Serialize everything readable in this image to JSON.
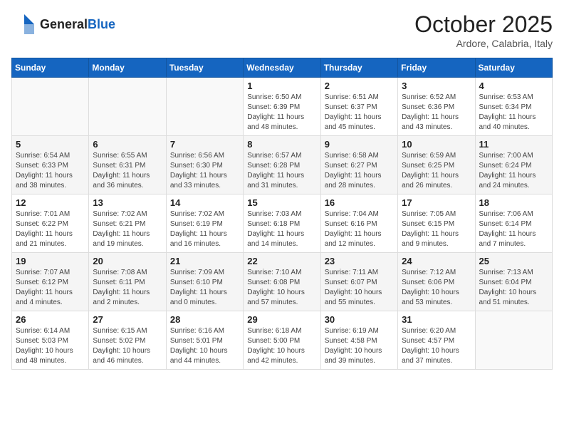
{
  "logo": {
    "general": "General",
    "blue": "Blue"
  },
  "header": {
    "month": "October 2025",
    "location": "Ardore, Calabria, Italy"
  },
  "weekdays": [
    "Sunday",
    "Monday",
    "Tuesday",
    "Wednesday",
    "Thursday",
    "Friday",
    "Saturday"
  ],
  "weeks": [
    [
      {
        "day": "",
        "info": ""
      },
      {
        "day": "",
        "info": ""
      },
      {
        "day": "",
        "info": ""
      },
      {
        "day": "1",
        "info": "Sunrise: 6:50 AM\nSunset: 6:39 PM\nDaylight: 11 hours\nand 48 minutes."
      },
      {
        "day": "2",
        "info": "Sunrise: 6:51 AM\nSunset: 6:37 PM\nDaylight: 11 hours\nand 45 minutes."
      },
      {
        "day": "3",
        "info": "Sunrise: 6:52 AM\nSunset: 6:36 PM\nDaylight: 11 hours\nand 43 minutes."
      },
      {
        "day": "4",
        "info": "Sunrise: 6:53 AM\nSunset: 6:34 PM\nDaylight: 11 hours\nand 40 minutes."
      }
    ],
    [
      {
        "day": "5",
        "info": "Sunrise: 6:54 AM\nSunset: 6:33 PM\nDaylight: 11 hours\nand 38 minutes."
      },
      {
        "day": "6",
        "info": "Sunrise: 6:55 AM\nSunset: 6:31 PM\nDaylight: 11 hours\nand 36 minutes."
      },
      {
        "day": "7",
        "info": "Sunrise: 6:56 AM\nSunset: 6:30 PM\nDaylight: 11 hours\nand 33 minutes."
      },
      {
        "day": "8",
        "info": "Sunrise: 6:57 AM\nSunset: 6:28 PM\nDaylight: 11 hours\nand 31 minutes."
      },
      {
        "day": "9",
        "info": "Sunrise: 6:58 AM\nSunset: 6:27 PM\nDaylight: 11 hours\nand 28 minutes."
      },
      {
        "day": "10",
        "info": "Sunrise: 6:59 AM\nSunset: 6:25 PM\nDaylight: 11 hours\nand 26 minutes."
      },
      {
        "day": "11",
        "info": "Sunrise: 7:00 AM\nSunset: 6:24 PM\nDaylight: 11 hours\nand 24 minutes."
      }
    ],
    [
      {
        "day": "12",
        "info": "Sunrise: 7:01 AM\nSunset: 6:22 PM\nDaylight: 11 hours\nand 21 minutes."
      },
      {
        "day": "13",
        "info": "Sunrise: 7:02 AM\nSunset: 6:21 PM\nDaylight: 11 hours\nand 19 minutes."
      },
      {
        "day": "14",
        "info": "Sunrise: 7:02 AM\nSunset: 6:19 PM\nDaylight: 11 hours\nand 16 minutes."
      },
      {
        "day": "15",
        "info": "Sunrise: 7:03 AM\nSunset: 6:18 PM\nDaylight: 11 hours\nand 14 minutes."
      },
      {
        "day": "16",
        "info": "Sunrise: 7:04 AM\nSunset: 6:16 PM\nDaylight: 11 hours\nand 12 minutes."
      },
      {
        "day": "17",
        "info": "Sunrise: 7:05 AM\nSunset: 6:15 PM\nDaylight: 11 hours\nand 9 minutes."
      },
      {
        "day": "18",
        "info": "Sunrise: 7:06 AM\nSunset: 6:14 PM\nDaylight: 11 hours\nand 7 minutes."
      }
    ],
    [
      {
        "day": "19",
        "info": "Sunrise: 7:07 AM\nSunset: 6:12 PM\nDaylight: 11 hours\nand 4 minutes."
      },
      {
        "day": "20",
        "info": "Sunrise: 7:08 AM\nSunset: 6:11 PM\nDaylight: 11 hours\nand 2 minutes."
      },
      {
        "day": "21",
        "info": "Sunrise: 7:09 AM\nSunset: 6:10 PM\nDaylight: 11 hours\nand 0 minutes."
      },
      {
        "day": "22",
        "info": "Sunrise: 7:10 AM\nSunset: 6:08 PM\nDaylight: 10 hours\nand 57 minutes."
      },
      {
        "day": "23",
        "info": "Sunrise: 7:11 AM\nSunset: 6:07 PM\nDaylight: 10 hours\nand 55 minutes."
      },
      {
        "day": "24",
        "info": "Sunrise: 7:12 AM\nSunset: 6:06 PM\nDaylight: 10 hours\nand 53 minutes."
      },
      {
        "day": "25",
        "info": "Sunrise: 7:13 AM\nSunset: 6:04 PM\nDaylight: 10 hours\nand 51 minutes."
      }
    ],
    [
      {
        "day": "26",
        "info": "Sunrise: 6:14 AM\nSunset: 5:03 PM\nDaylight: 10 hours\nand 48 minutes."
      },
      {
        "day": "27",
        "info": "Sunrise: 6:15 AM\nSunset: 5:02 PM\nDaylight: 10 hours\nand 46 minutes."
      },
      {
        "day": "28",
        "info": "Sunrise: 6:16 AM\nSunset: 5:01 PM\nDaylight: 10 hours\nand 44 minutes."
      },
      {
        "day": "29",
        "info": "Sunrise: 6:18 AM\nSunset: 5:00 PM\nDaylight: 10 hours\nand 42 minutes."
      },
      {
        "day": "30",
        "info": "Sunrise: 6:19 AM\nSunset: 4:58 PM\nDaylight: 10 hours\nand 39 minutes."
      },
      {
        "day": "31",
        "info": "Sunrise: 6:20 AM\nSunset: 4:57 PM\nDaylight: 10 hours\nand 37 minutes."
      },
      {
        "day": "",
        "info": ""
      }
    ]
  ]
}
